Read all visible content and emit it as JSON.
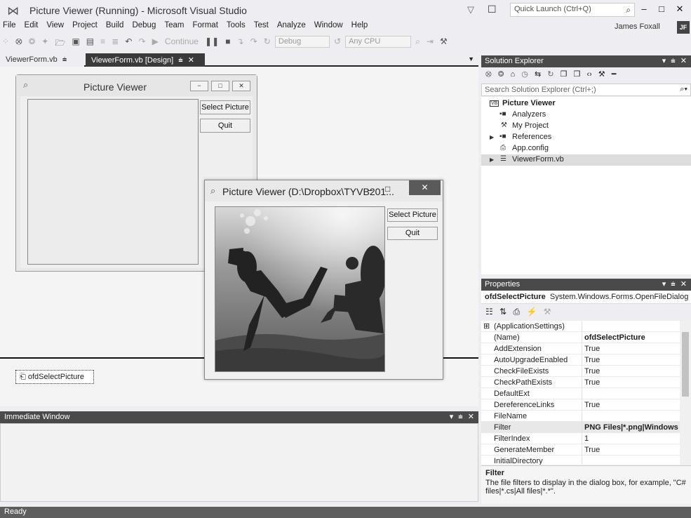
{
  "window": {
    "title": "Picture Viewer (Running) - Microsoft Visual Studio",
    "quick_launch_placeholder": "Quick Launch (Ctrl+Q)",
    "minimize": "–",
    "maximize": "□",
    "close": "✕"
  },
  "menu": [
    "File",
    "Edit",
    "View",
    "Project",
    "Build",
    "Debug",
    "Team",
    "Format",
    "Tools",
    "Test",
    "Analyze",
    "Window",
    "Help"
  ],
  "user": {
    "name": "James Foxall",
    "initials": "JF"
  },
  "toolbar": {
    "continue_label": "Continue",
    "config": "Debug",
    "platform": "Any CPU"
  },
  "tabs": [
    {
      "label": "ViewerForm.vb",
      "pin": "ᴵ"
    },
    {
      "label": "ViewerForm.vb [Design]",
      "pin": "ᴵ",
      "close": "✕"
    }
  ],
  "design_form": {
    "title": "Picture Viewer",
    "select_button": "Select Picture",
    "quit_button": "Quit"
  },
  "tray": {
    "component": "ofdSelectPicture"
  },
  "running_form": {
    "title": "Picture Viewer (D:\\Dropbox\\TYVB201...",
    "select_button": "Select Picture",
    "quit_button": "Quit"
  },
  "immediate_window": {
    "title": "Immediate Window"
  },
  "status": {
    "text": "Ready"
  },
  "solution_explorer": {
    "title": "Solution Explorer",
    "search_placeholder": "Search Solution Explorer (Ctrl+;)",
    "tree": [
      {
        "label": "Picture Viewer",
        "icon": "VB",
        "bold": true
      },
      {
        "label": "Analyzers",
        "icon": "▪■"
      },
      {
        "label": "My Project",
        "icon": "⚒"
      },
      {
        "label": "References",
        "icon": "▪■",
        "expander": "▶"
      },
      {
        "label": "App.config",
        "icon": "⎙"
      },
      {
        "label": "ViewerForm.vb",
        "icon": "☰",
        "expander": "▶",
        "selected": true
      }
    ]
  },
  "properties": {
    "title": "Properties",
    "object_name": "ofdSelectPicture",
    "object_type": "System.Windows.Forms.OpenFileDialog",
    "rows": [
      {
        "name": "(ApplicationSettings)",
        "value": "",
        "expander": "⊞"
      },
      {
        "name": "(Name)",
        "value": "ofdSelectPicture",
        "bold": true
      },
      {
        "name": "AddExtension",
        "value": "True"
      },
      {
        "name": "AutoUpgradeEnabled",
        "value": "True"
      },
      {
        "name": "CheckFileExists",
        "value": "True"
      },
      {
        "name": "CheckPathExists",
        "value": "True"
      },
      {
        "name": "DefaultExt",
        "value": ""
      },
      {
        "name": "DereferenceLinks",
        "value": "True"
      },
      {
        "name": "FileName",
        "value": ""
      },
      {
        "name": "Filter",
        "value": "PNG Files|*.png|Windows Bit",
        "bold": true,
        "selected": true
      },
      {
        "name": "FilterIndex",
        "value": "1"
      },
      {
        "name": "GenerateMember",
        "value": "True"
      },
      {
        "name": "InitialDirectory",
        "value": ""
      }
    ],
    "description_title": "Filter",
    "description_text": "The file filters to display in the dialog box, for example, \"C# files|*.cs|All files|*.*\"."
  },
  "colors": {
    "pane_header": "#4a4a4a",
    "status_bar": "#5e5e5e",
    "active_tab": "#3a3a3a"
  }
}
